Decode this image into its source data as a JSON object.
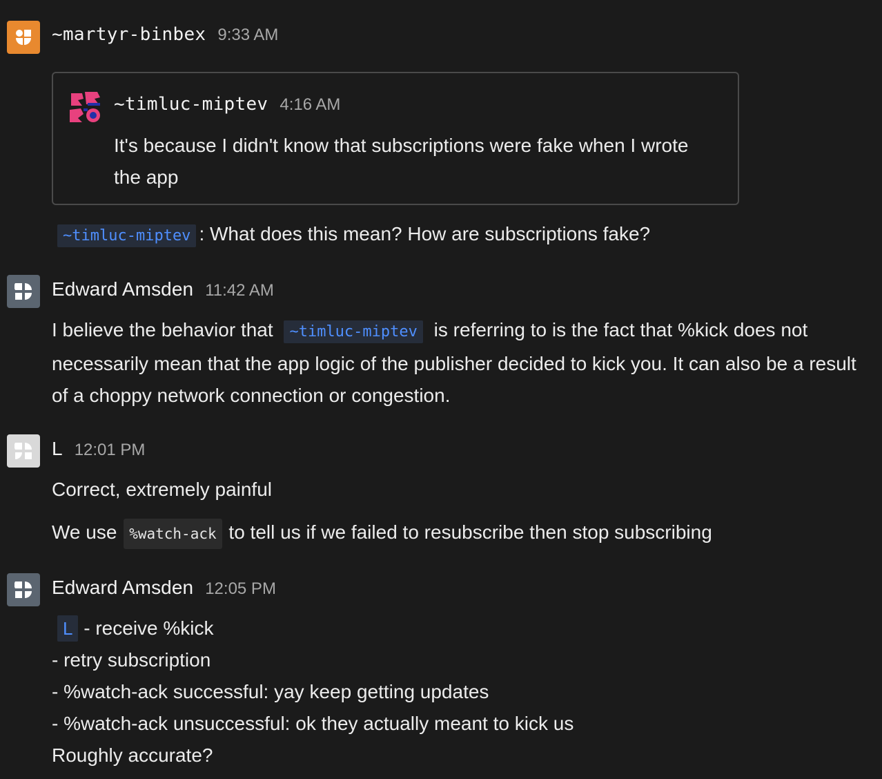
{
  "messages": [
    {
      "author": "~martyr-binbex",
      "time": "9:33 AM",
      "quote": {
        "author": "~timluc-miptev",
        "time": "4:16 AM",
        "text": "It's because I didn't know that subscriptions were fake when I wrote the app"
      },
      "mention": "~timluc-miptev",
      "text": ": What does this mean? How are subscriptions fake?"
    },
    {
      "author": "Edward Amsden",
      "time": "11:42 AM",
      "text_before": "I believe the behavior that",
      "mention": "~timluc-miptev",
      "text_after": "is referring to is the fact that %kick does not necessarily mean that the app logic of the publisher decided to kick you. It can also be a result of a choppy network connection or congestion."
    },
    {
      "author": "L",
      "time": "12:01 PM",
      "line1": "Correct, extremely painful",
      "line2_before": "We use",
      "code": "%watch-ack",
      "line2_after": "to tell us if we failed to resubscribe then stop subscribing"
    },
    {
      "author": "Edward Amsden",
      "time": "12:05 PM",
      "mention": "L",
      "line1_after": "- receive %kick",
      "line2": "- retry subscription",
      "line3": "- %watch-ack successful: yay keep getting updates",
      "line4": "- %watch-ack unsuccessful: ok they actually meant to kick us",
      "line5": "Roughly accurate?"
    }
  ],
  "colors": {
    "background": "#1b1b1b",
    "mention": "#4f8fff",
    "avatar_orange": "#e8892f",
    "avatar_slate": "#5b6570",
    "avatar_light": "#d9d9d9",
    "sigil_pink": "#e8417e",
    "sigil_blue": "#2230a8"
  },
  "icons": {
    "martyr_avatar": "sigil-avatar-icon",
    "timluc_avatar": "sigil-avatar-icon",
    "edward_avatar": "sigil-avatar-icon",
    "l_avatar": "sigil-avatar-icon"
  }
}
